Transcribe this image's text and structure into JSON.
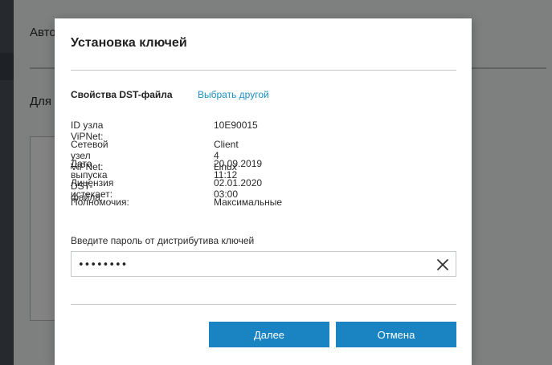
{
  "background": {
    "header_text": "Авто",
    "body_text": "Для"
  },
  "dialog": {
    "title": "Установка ключей",
    "section_title": "Свойства DST-файла",
    "choose_other_link": "Выбрать другой",
    "properties": [
      {
        "label": "ID узла ViPNet:",
        "value": "10E90015"
      },
      {
        "label": "Сетевой узел ViPNet:",
        "value": "Client 4 Linux"
      },
      {
        "label": "Дата выпуска DST-файла:",
        "value": "20.09.2019 11:12"
      },
      {
        "label": "Лицензия истекает:",
        "value": "02.01.2020 03:00"
      },
      {
        "label": "Полномочия:",
        "value": "Максимальные"
      }
    ],
    "password_label": "Введите пароль от дистрибутива ключей",
    "password_value": "••••••••",
    "clear_icon": "close-icon",
    "next_button": "Далее",
    "cancel_button": "Отмена"
  },
  "colors": {
    "accent": "#1a84c2",
    "link": "#1a8fc4",
    "overlay": "rgba(0,0,0,0.48)"
  }
}
